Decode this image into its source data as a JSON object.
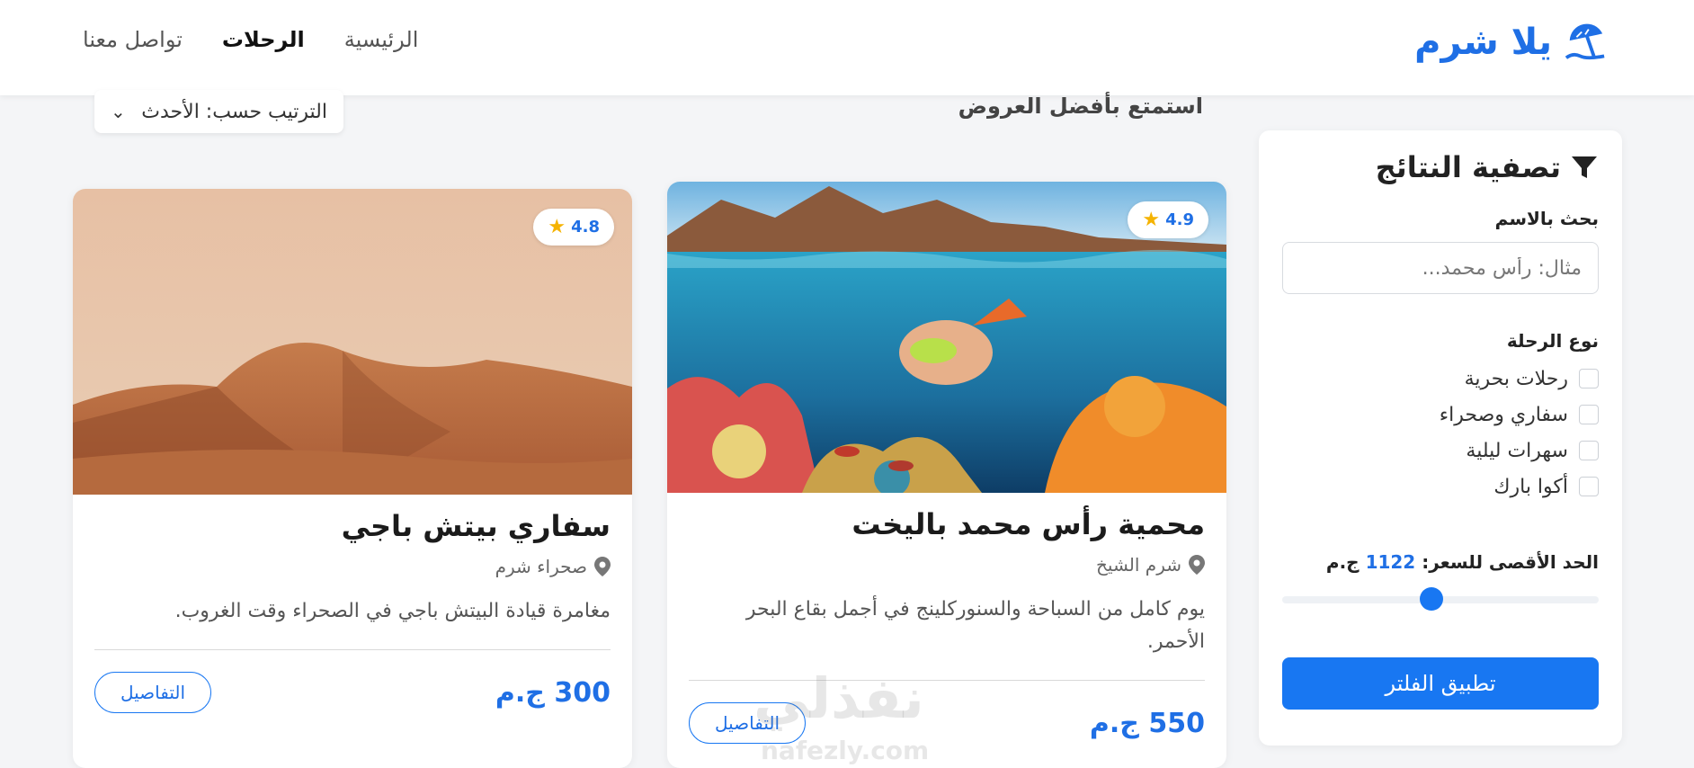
{
  "navbar": {
    "brand": "يلا شرم",
    "brand_icon": "beach-umbrella-icon",
    "links": [
      {
        "label": "الرئيسية",
        "active": false
      },
      {
        "label": "الرحلات",
        "active": true
      },
      {
        "label": "تواصل معنا",
        "active": false
      }
    ]
  },
  "header": {
    "subtitle": "استمتع بأفضل العروض",
    "sort_label": "الترتيب حسب: الأحدث"
  },
  "sidebar": {
    "title": "تصفية النتائج",
    "search_label": "بحث بالاسم",
    "search_placeholder": "مثال: رأس محمد...",
    "search_value": "",
    "type_label": "نوع الرحلة",
    "types": [
      "رحلات بحرية",
      "سفاري وصحراء",
      "سهرات ليلية",
      "أكوا بارك"
    ],
    "price_label": "الحد الأقصى للسعر:",
    "price_value": "1122",
    "price_unit": "ج.م",
    "price_fraction": 0.53,
    "apply_label": "تطبيق الفلتر"
  },
  "cards": [
    {
      "rating": "4.9",
      "title": "محمية رأس محمد باليخت",
      "location": "شرم الشيخ",
      "description": "يوم كامل من السباحة والسنوركلينج في أجمل بقاع البحر الأحمر.",
      "price": "550 ج.م",
      "details_label": "التفاصيل"
    },
    {
      "rating": "4.8",
      "title": "سفاري بيتش باجي",
      "location": "صحراء شرم",
      "description": "مغامرة قيادة البيتش باجي في الصحراء وقت الغروب.",
      "price": "300 ج.م",
      "details_label": "التفاصيل"
    }
  ],
  "watermark": {
    "arabic": "نفذلي",
    "latin": "nafezly.com"
  },
  "colors": {
    "accent": "#1877f2",
    "brand": "#1f6fe5",
    "star": "#f5b301"
  }
}
